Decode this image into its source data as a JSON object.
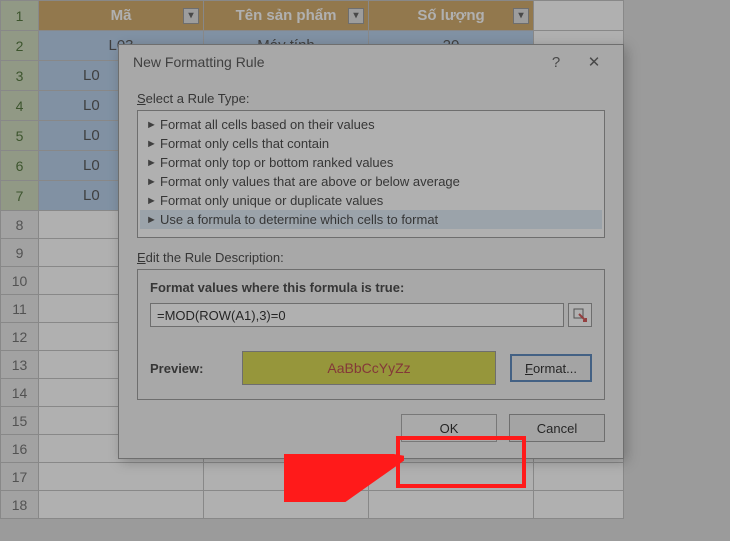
{
  "sheet": {
    "headers": [
      "Mã",
      "Tên sản phẩm",
      "Số lượng"
    ],
    "rows": [
      {
        "ma": "L03",
        "ten": "Máy tính",
        "sl": "20"
      },
      {
        "ma": "L0"
      },
      {
        "ma": "L0"
      },
      {
        "ma": "L0"
      },
      {
        "ma": "L0"
      },
      {
        "ma": "L0"
      }
    ],
    "rownums": [
      "1",
      "2",
      "3",
      "4",
      "5",
      "6",
      "7",
      "8",
      "9",
      "10",
      "11",
      "12",
      "13",
      "14",
      "15",
      "16",
      "17",
      "18"
    ]
  },
  "dialog": {
    "title": "New Formatting Rule",
    "help": "?",
    "close": "✕",
    "select_label_pre": "S",
    "select_label_rest": "elect a Rule Type:",
    "rules": [
      "Format all cells based on their values",
      "Format only cells that contain",
      "Format only top or bottom ranked values",
      "Format only values that are above or below average",
      "Format only unique or duplicate values",
      "Use a formula to determine which cells to format"
    ],
    "edit_label_pre": "E",
    "edit_label_rest": "dit the Rule Description:",
    "formula_label": "Format values where this formula is true:",
    "formula": "=MOD(ROW(A1),3)=0",
    "preview_label": "Preview:",
    "preview_text": "AaBbCcYyZz",
    "format_btn_pre": "F",
    "format_btn_rest": "ormat...",
    "ok": "OK",
    "cancel": "Cancel"
  }
}
